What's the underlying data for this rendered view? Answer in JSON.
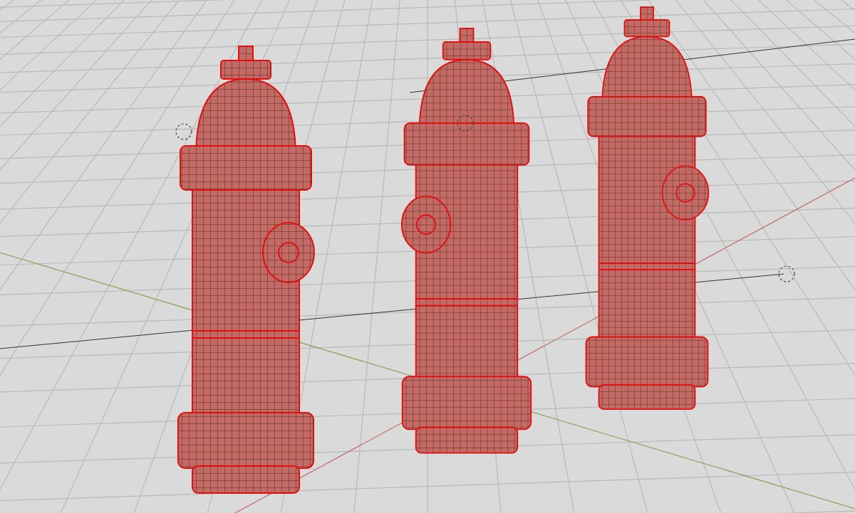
{
  "viewport": {
    "objects": [
      {
        "kind": "hydrant"
      },
      {
        "kind": "hydrant"
      },
      {
        "kind": "hydrant"
      },
      {
        "kind": "empty"
      },
      {
        "kind": "empty"
      },
      {
        "kind": "empty"
      }
    ]
  }
}
